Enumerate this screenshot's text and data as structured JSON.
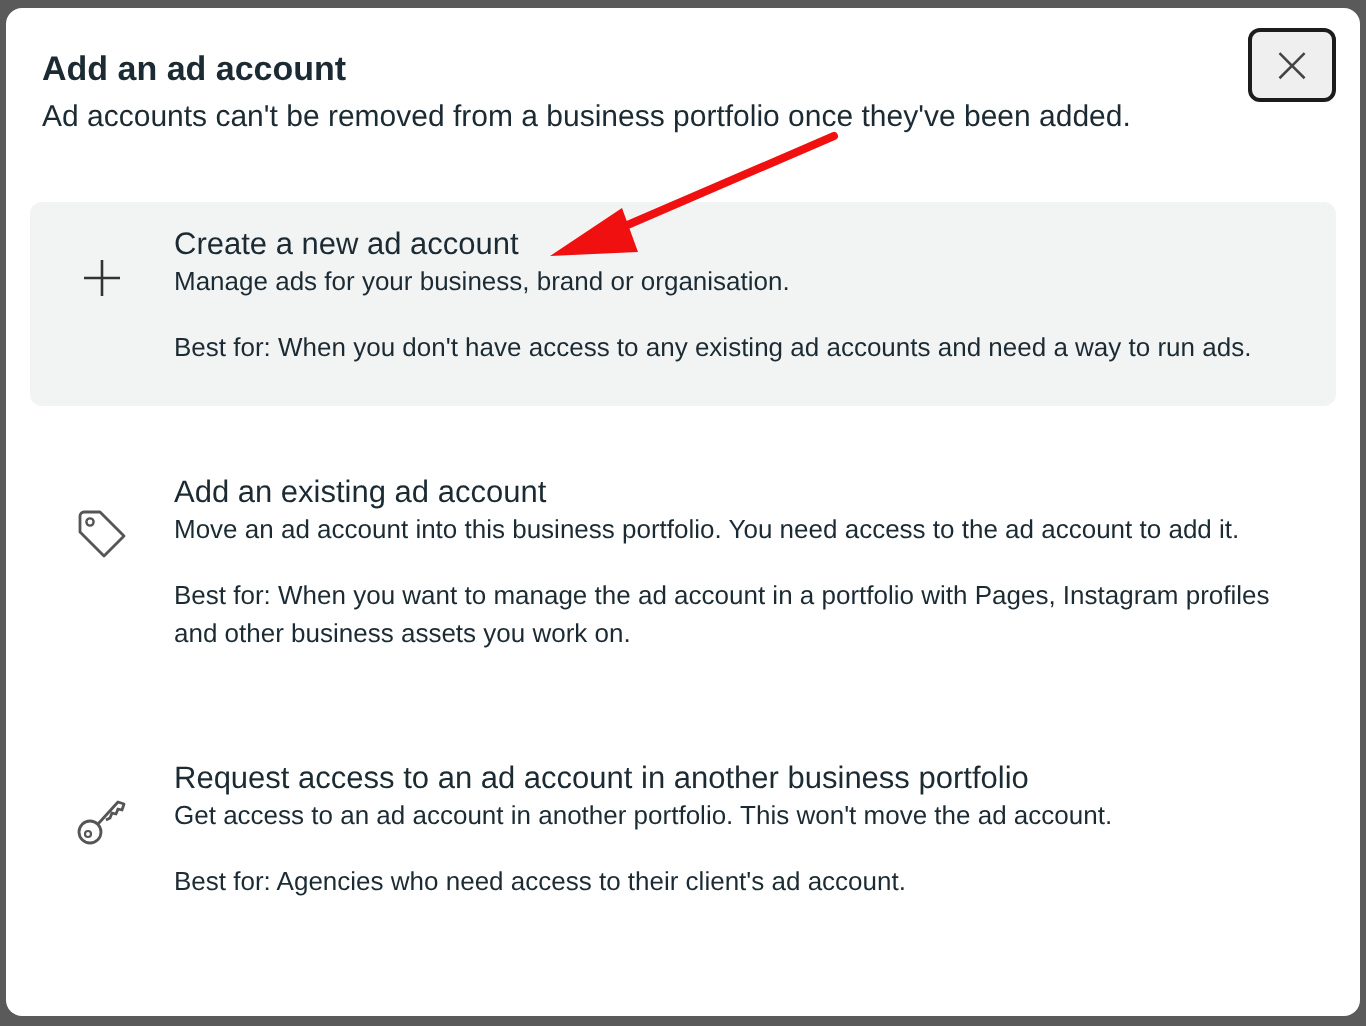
{
  "dialog": {
    "title": "Add an ad account",
    "subtitle": "Ad accounts can't be removed from a business portfolio once they've been added.",
    "close": "×"
  },
  "options": [
    {
      "kind": "plus",
      "title": "Create a new ad account",
      "description": "Manage ads for your business, brand or organisation.",
      "best_for": "Best for: When you don't have access to any existing ad accounts and need a way to run ads.",
      "selected": true
    },
    {
      "kind": "tag",
      "title": "Add an existing ad account",
      "description": "Move an ad account into this business portfolio. You need access to the ad account to add it.",
      "best_for": "Best for: When you want to manage the ad account in a portfolio with Pages, Instagram profiles and other business assets you work on.",
      "selected": false
    },
    {
      "kind": "key",
      "title": "Request access to an ad account in another business portfolio",
      "description": "Get access to an ad account in another portfolio. This won't move the ad account.",
      "best_for": "Best for: Agencies who need access to their client's ad account.",
      "selected": false
    }
  ]
}
